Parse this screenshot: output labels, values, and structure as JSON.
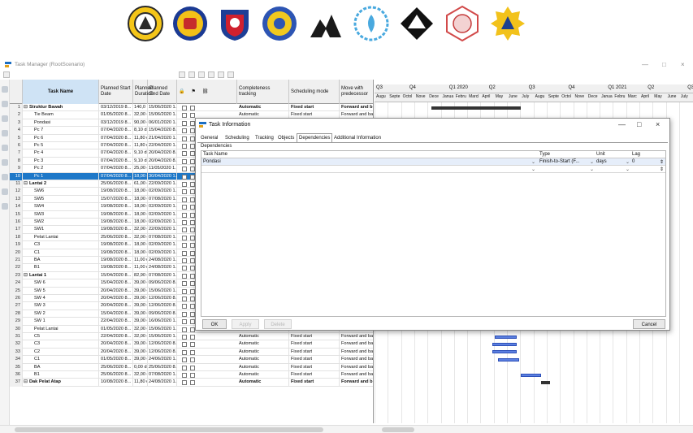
{
  "window": {
    "title": "Task Manager (RootScenario)",
    "controls": {
      "minimize": "—",
      "maximize": "□",
      "close": "×"
    }
  },
  "grid": {
    "headers": {
      "task_name": "Task Name",
      "planned_start": "Planned Start Date",
      "planned_duration": "Planned Duration",
      "planned_end": "Planned End Date",
      "completeness": "Completeness tracking",
      "scheduling": "Scheduling mode",
      "move": "Move with predecessor"
    },
    "rows": [
      {
        "num": "1",
        "name": "Struktur Bawah",
        "group": true,
        "start": "03/12/2019 8...",
        "dur": "140,0",
        "end": "15/06/2020 1...",
        "ct": "Automatic",
        "sm": "Fixed start",
        "mv": "Forward and b"
      },
      {
        "num": "2",
        "name": "Tie Beam",
        "start": "01/05/2020 8...",
        "dur": "32,00 d",
        "end": "15/06/2020 1...",
        "ct": "Automatic",
        "sm": "Fixed start",
        "mv": "Forward and ba"
      },
      {
        "num": "3",
        "name": "Pondasi",
        "start": "03/12/2019 8...",
        "dur": "90,00 d",
        "end": "06/01/2020 1...",
        "ct": "",
        "sm": "",
        "mv": ""
      },
      {
        "num": "4",
        "name": "Pc 7",
        "start": "07/04/2020 8...",
        "dur": "8,10 d",
        "end": "15/04/2020 8...",
        "ct": "",
        "sm": "",
        "mv": ""
      },
      {
        "num": "5",
        "name": "Pc 6",
        "start": "07/04/2020 8...",
        "dur": "11,80 d",
        "end": "21/04/2020 1...",
        "ct": "",
        "sm": "",
        "mv": ""
      },
      {
        "num": "6",
        "name": "Pc 5",
        "start": "07/04/2020 8...",
        "dur": "11,80 d",
        "end": "22/04/2020 1...",
        "ct": "",
        "sm": "",
        "mv": ""
      },
      {
        "num": "7",
        "name": "Pc 4",
        "start": "07/04/2020 8...",
        "dur": "9,10 d",
        "end": "20/04/2020 8...",
        "ct": "",
        "sm": "",
        "mv": ""
      },
      {
        "num": "8",
        "name": "Pc 3",
        "start": "07/04/2020 8...",
        "dur": "9,10 d",
        "end": "20/04/2020 8...",
        "ct": "",
        "sm": "",
        "mv": ""
      },
      {
        "num": "9",
        "name": "Pc 2",
        "start": "07/04/2020 8...",
        "dur": "25,00 d",
        "end": "11/05/2020 1...",
        "ct": "",
        "sm": "",
        "mv": ""
      },
      {
        "num": "10",
        "name": "Pc 1",
        "selected": true,
        "start": "07/04/2020 8...",
        "dur": "18,00 d",
        "end": "30/04/2020 1...",
        "ct": "",
        "sm": "",
        "mv": ""
      },
      {
        "num": "11",
        "name": "Lantai 2",
        "group": true,
        "start": "25/06/2020 8...",
        "dur": "61,00 d",
        "end": "22/09/2020 1...",
        "ct": "",
        "sm": "",
        "mv": ""
      },
      {
        "num": "12",
        "name": "SW6",
        "start": "19/08/2020 8...",
        "dur": "18,00 d",
        "end": "02/09/2020 1...",
        "ct": "",
        "sm": "",
        "mv": ""
      },
      {
        "num": "13",
        "name": "SW5",
        "start": "15/07/2020 8...",
        "dur": "18,00 d",
        "end": "07/08/2020 1...",
        "ct": "",
        "sm": "",
        "mv": ""
      },
      {
        "num": "14",
        "name": "SW4",
        "start": "19/08/2020 8...",
        "dur": "18,00 d",
        "end": "02/09/2020 1...",
        "ct": "",
        "sm": "",
        "mv": ""
      },
      {
        "num": "15",
        "name": "SW3",
        "start": "19/08/2020 8...",
        "dur": "18,00 d",
        "end": "02/09/2020 1...",
        "ct": "",
        "sm": "",
        "mv": ""
      },
      {
        "num": "16",
        "name": "SW2",
        "start": "19/08/2020 8...",
        "dur": "18,00 d",
        "end": "02/09/2020 1...",
        "ct": "",
        "sm": "",
        "mv": ""
      },
      {
        "num": "17",
        "name": "SW1",
        "start": "19/08/2020 8...",
        "dur": "32,00 d",
        "end": "22/09/2020 1...",
        "ct": "",
        "sm": "",
        "mv": ""
      },
      {
        "num": "18",
        "name": "Pelat Lantai",
        "start": "25/06/2020 8...",
        "dur": "32,00 d",
        "end": "07/08/2020 1...",
        "ct": "",
        "sm": "",
        "mv": ""
      },
      {
        "num": "19",
        "name": "C3",
        "start": "19/08/2020 8...",
        "dur": "18,00 d",
        "end": "02/09/2020 1...",
        "ct": "",
        "sm": "",
        "mv": ""
      },
      {
        "num": "20",
        "name": "C1",
        "start": "19/08/2020 8...",
        "dur": "18,00 d",
        "end": "02/09/2020 1...",
        "ct": "",
        "sm": "",
        "mv": ""
      },
      {
        "num": "21",
        "name": "BA",
        "start": "19/08/2020 8...",
        "dur": "11,00 d",
        "end": "24/08/2020 1...",
        "ct": "",
        "sm": "",
        "mv": ""
      },
      {
        "num": "22",
        "name": "B1",
        "start": "19/08/2020 8...",
        "dur": "11,00 d",
        "end": "24/08/2020 1...",
        "ct": "",
        "sm": "",
        "mv": ""
      },
      {
        "num": "23",
        "name": "Lantai 1",
        "group": true,
        "start": "15/04/2020 8...",
        "dur": "82,90 d",
        "end": "07/08/2020 1...",
        "ct": "",
        "sm": "",
        "mv": ""
      },
      {
        "num": "24",
        "name": "SW 6",
        "start": "15/04/2020 8...",
        "dur": "39,00 d",
        "end": "09/06/2020 8...",
        "ct": "",
        "sm": "",
        "mv": ""
      },
      {
        "num": "25",
        "name": "SW 5",
        "start": "20/04/2020 8...",
        "dur": "39,00 d",
        "end": "15/06/2020 1...",
        "ct": "",
        "sm": "",
        "mv": ""
      },
      {
        "num": "26",
        "name": "SW 4",
        "start": "20/04/2020 8...",
        "dur": "39,00 d",
        "end": "12/06/2020 8...",
        "ct": "",
        "sm": "",
        "mv": ""
      },
      {
        "num": "27",
        "name": "SW 3",
        "start": "20/04/2020 8...",
        "dur": "39,00 d",
        "end": "12/06/2020 8...",
        "ct": "Automatic",
        "sm": "Fixed start",
        "mv": "Forward and ba"
      },
      {
        "num": "28",
        "name": "SW 2",
        "start": "15/04/2020 8...",
        "dur": "39,00 d",
        "end": "09/06/2020 8...",
        "ct": "Automatic",
        "sm": "Fixed start",
        "mv": "Forward and ba"
      },
      {
        "num": "29",
        "name": "SW 1",
        "start": "22/04/2020 8...",
        "dur": "39,00 d",
        "end": "16/06/2020 1...",
        "ct": "Automatic",
        "sm": "Fixed start",
        "mv": "Forward and ba"
      },
      {
        "num": "30",
        "name": "Pelat Lantai",
        "start": "01/05/2020 8...",
        "dur": "32,00 d",
        "end": "15/06/2020 1...",
        "ct": "Automatic",
        "sm": "Fixed start",
        "mv": "Forward and ba"
      },
      {
        "num": "31",
        "name": "C5",
        "start": "22/04/2020 8...",
        "dur": "32,00 d",
        "end": "15/06/2020 1...",
        "ct": "Automatic",
        "sm": "Fixed start",
        "mv": "Forward and ba"
      },
      {
        "num": "32",
        "name": "C3",
        "start": "20/04/2020 8...",
        "dur": "39,00 d",
        "end": "12/06/2020 8...",
        "ct": "Automatic",
        "sm": "Fixed start",
        "mv": "Forward and ba"
      },
      {
        "num": "33",
        "name": "C2",
        "start": "20/04/2020 8...",
        "dur": "39,00 d",
        "end": "12/06/2020 8...",
        "ct": "Automatic",
        "sm": "Fixed start",
        "mv": "Forward and ba"
      },
      {
        "num": "34",
        "name": "C1",
        "start": "01/05/2020 8...",
        "dur": "39,00 d",
        "end": "24/06/2020 1...",
        "ct": "Automatic",
        "sm": "Fixed start",
        "mv": "Forward and ba"
      },
      {
        "num": "35",
        "name": "BA",
        "start": "25/06/2020 8...",
        "dur": "0,00 d",
        "end": "25/06/2020 8...",
        "ct": "Automatic",
        "sm": "Fixed start",
        "mv": "Forward and ba"
      },
      {
        "num": "36",
        "name": "B1",
        "start": "25/06/2020 8...",
        "dur": "32,00 d",
        "end": "07/08/2020 1...",
        "ct": "Automatic",
        "sm": "Fixed start",
        "mv": "Forward and ba"
      },
      {
        "num": "37",
        "name": "Dak Pelat Atap",
        "group": true,
        "start": "10/08/2020 8...",
        "dur": "11,80 d",
        "end": "24/08/2020 1...",
        "ct": "Automatic",
        "sm": "Fixed start",
        "mv": "Forward and b"
      }
    ]
  },
  "gantt": {
    "top_labels": [
      "Q3",
      "Q4",
      "Q1 2020",
      "Q2",
      "Q3",
      "Q4",
      "Q1 2021",
      "Q2",
      "Q3"
    ],
    "months": [
      "Augu",
      "Septe",
      "Octol",
      "Nove",
      "Dece",
      "Janua",
      "Febru",
      "Marcl",
      "April",
      "May",
      "June",
      "July",
      "Augu",
      "Septe",
      "Octol",
      "Nove",
      "Dece",
      "Janua",
      "Febru",
      "Marc",
      "April",
      "May",
      "June",
      "July"
    ]
  },
  "dialog": {
    "title": "Task Information",
    "tabs": [
      "General",
      "Scheduling",
      "Tracking",
      "Objects",
      "Dependencies",
      "Additional Information"
    ],
    "active_tab": "Dependencies",
    "section_label": "Dependencies",
    "columns": {
      "task_name": "Task Name",
      "type": "Type",
      "unit": "Unit",
      "lag": "Lag"
    },
    "row": {
      "task_name": "Pondasi",
      "type": "Finish-to-Start (F...",
      "unit": "days",
      "lag": "0"
    },
    "buttons": {
      "ok": "OK",
      "apply": "Apply",
      "delete": "Delete",
      "cancel": "Cancel"
    }
  }
}
